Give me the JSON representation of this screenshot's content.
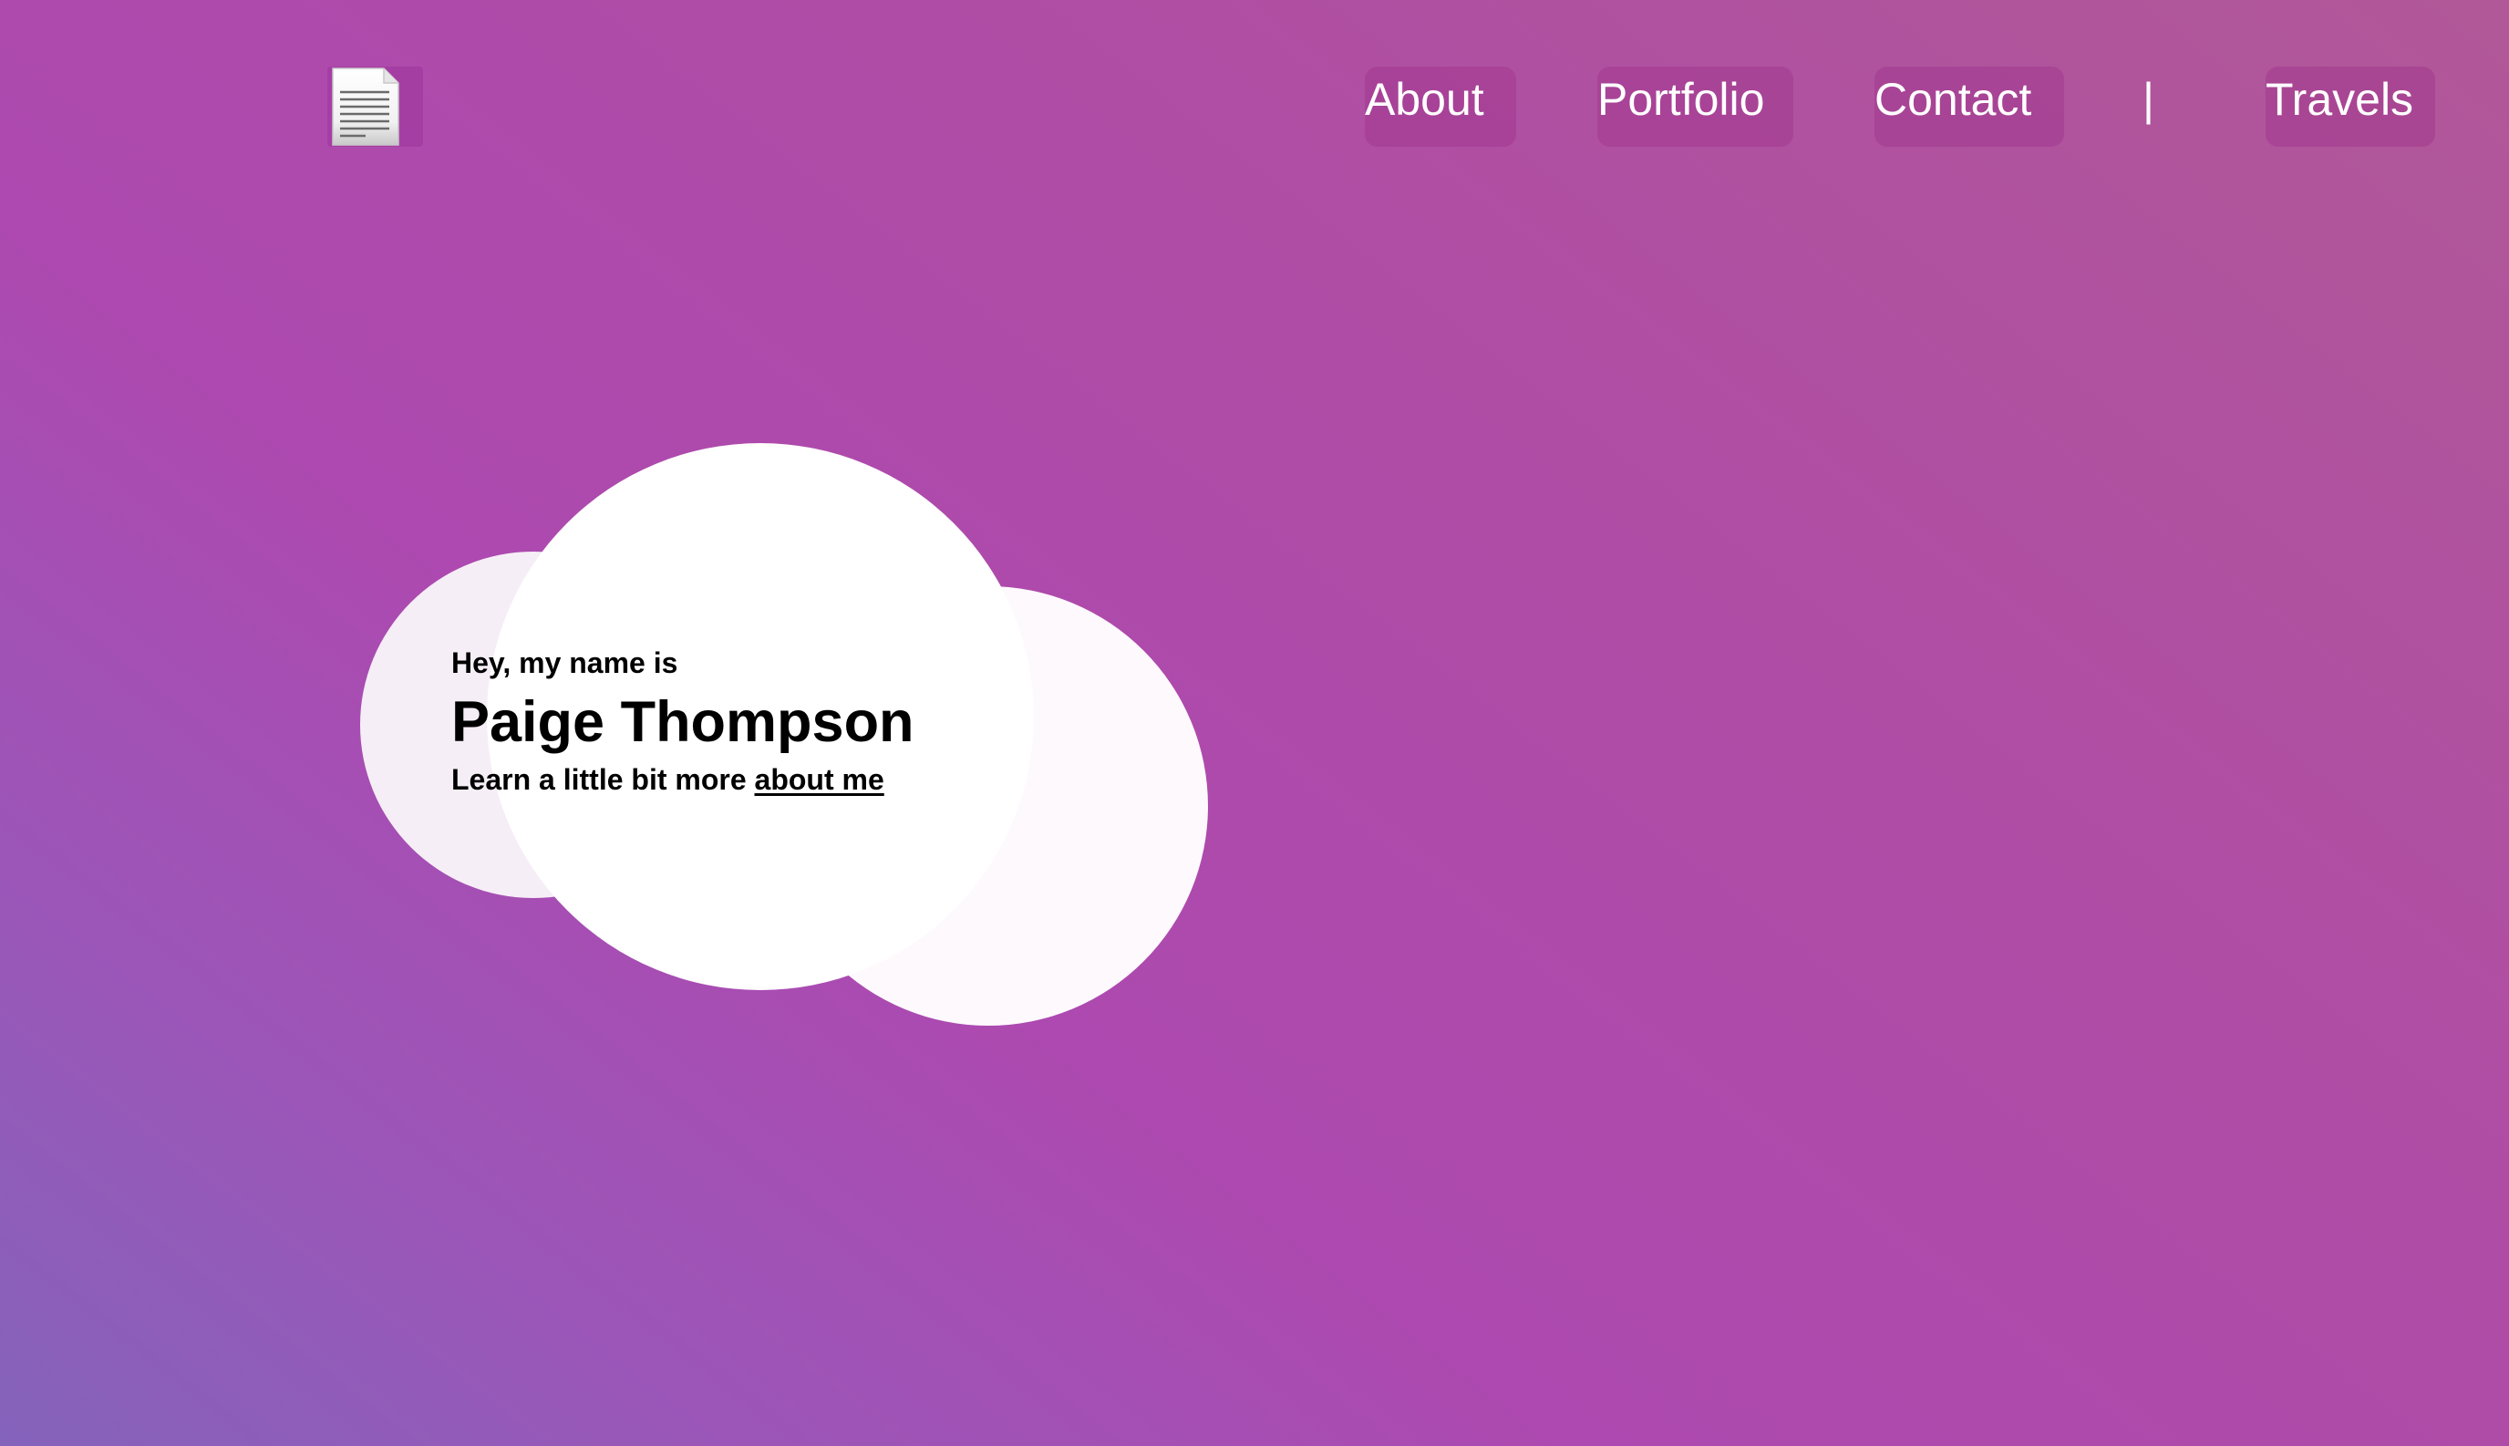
{
  "header": {
    "logo_icon": "document-icon",
    "nav": {
      "about": "About",
      "portfolio": "Portfolio",
      "contact": "Contact",
      "divider": "|",
      "travels": "Travels"
    }
  },
  "hero": {
    "greeting": "Hey, my name is",
    "name": "Paige Thompson",
    "learn_more_prefix": "Learn a little bit more",
    "about_link": "about me"
  },
  "colors": {
    "background_start": "#8463bb",
    "background_mid": "#ad49b0",
    "background_end": "#b15898",
    "text_on_background": "#ffffff",
    "cloud": "#ffffff"
  }
}
